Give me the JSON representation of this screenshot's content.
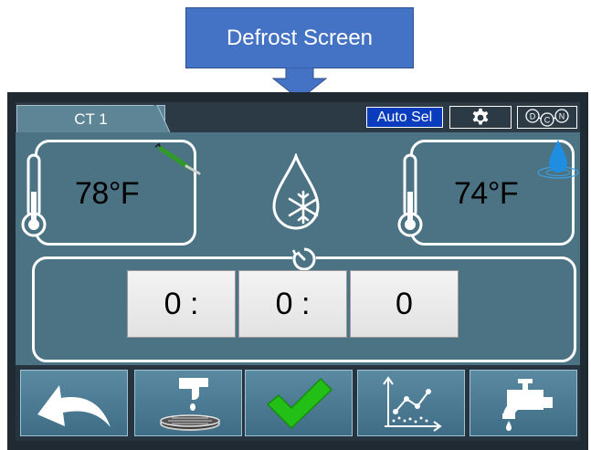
{
  "callout": {
    "label": "Defrost Screen",
    "color": "#4472c4"
  },
  "tabs": [
    {
      "label": "CT 1"
    }
  ],
  "toolbar": {
    "auto_sel_label": "Auto Sel",
    "settings_icon": "gear-icon",
    "molecule_icon": "dcn-molecule-icon",
    "molecule_letters": [
      "D",
      "C",
      "N"
    ]
  },
  "left_sensor": {
    "temperature": "78°F",
    "icons": [
      "thermometer-icon",
      "probe-icon"
    ]
  },
  "defrost_indicator": {
    "icon": "defrost-drop-snowflake-icon"
  },
  "right_sensor": {
    "temperature": "74°F",
    "icons": [
      "thermometer-icon",
      "water-drop-icon"
    ]
  },
  "timer": {
    "icon": "timer-icon",
    "fields": [
      "0 :",
      "0 :",
      "0"
    ]
  },
  "bottom_buttons": [
    {
      "name": "back",
      "icon": "back-arrow-icon"
    },
    {
      "name": "drain",
      "icon": "drain-faucet-icon"
    },
    {
      "name": "confirm",
      "icon": "checkmark-icon",
      "color": "#22c016"
    },
    {
      "name": "graph",
      "icon": "chart-icon"
    },
    {
      "name": "water",
      "icon": "faucet-icon"
    }
  ],
  "colors": {
    "screen_bg": "#4b7384",
    "auto_sel_bg": "#0a3dbd",
    "button_bg": "#4a7a92"
  }
}
